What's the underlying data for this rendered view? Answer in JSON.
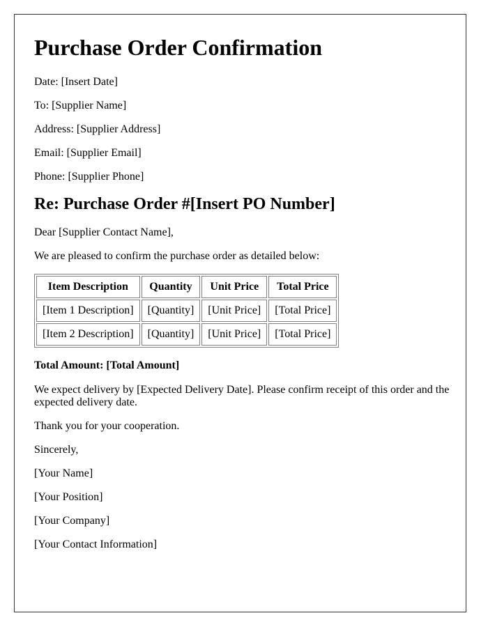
{
  "title": "Purchase Order Confirmation",
  "info": {
    "date": "Date: [Insert Date]",
    "to": "To: [Supplier Name]",
    "address": "Address: [Supplier Address]",
    "email": "Email: [Supplier Email]",
    "phone": "Phone: [Supplier Phone]"
  },
  "subject": "Re: Purchase Order #[Insert PO Number]",
  "salutation": "Dear [Supplier Contact Name],",
  "intro": "We are pleased to confirm the purchase order as detailed below:",
  "table": {
    "headers": [
      "Item Description",
      "Quantity",
      "Unit Price",
      "Total Price"
    ],
    "rows": [
      [
        "[Item 1 Description]",
        "[Quantity]",
        "[Unit Price]",
        "[Total Price]"
      ],
      [
        "[Item 2 Description]",
        "[Quantity]",
        "[Unit Price]",
        "[Total Price]"
      ]
    ]
  },
  "total_amount": "Total Amount: [Total Amount]",
  "delivery": "We expect delivery by [Expected Delivery Date]. Please confirm receipt of this order and the expected delivery date.",
  "thanks": "Thank you for your cooperation.",
  "closing": "Sincerely,",
  "signature": {
    "name": "[Your Name]",
    "position": "[Your Position]",
    "company": "[Your Company]",
    "contact": "[Your Contact Information]"
  }
}
